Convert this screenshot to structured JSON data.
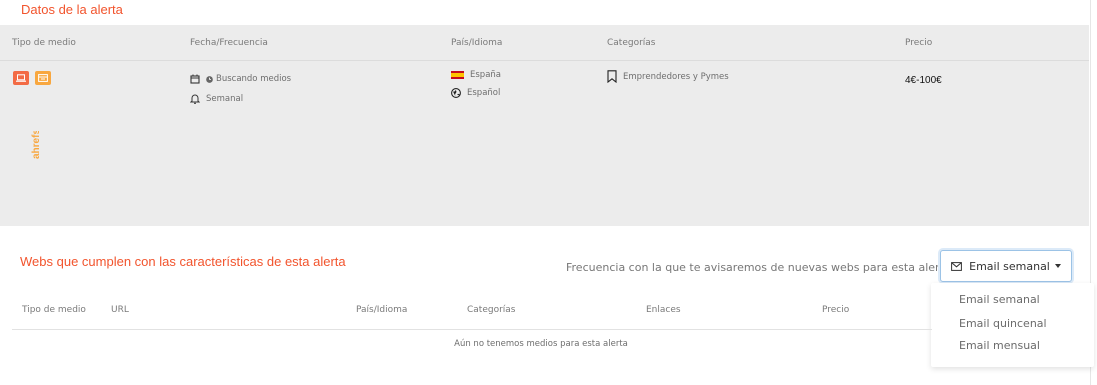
{
  "alert_section": {
    "title": "Datos de la alerta",
    "columns": [
      "Tipo de medio",
      "Fecha/Frecuencia",
      "País/Idioma",
      "Categorías",
      "Precio"
    ],
    "row": {
      "media_icons": [
        "laptop-icon",
        "browser-window-icon"
      ],
      "status": "Buscando medios",
      "frequency": "Semanal",
      "country": "España",
      "language": "Español",
      "category": "Emprendedores y Pymes",
      "price": "4€-100€",
      "logo_text": "ahrefs"
    }
  },
  "webs_section": {
    "title": "Webs que cumplen con las características de esta alerta",
    "frequency_label": "Frecuencia con la que te avisaremos de nuevas webs para esta alerta:",
    "dropdown": {
      "selected": "Email semanal",
      "options": [
        "Email semanal",
        "Email quincenal",
        "Email mensual"
      ]
    },
    "columns": [
      "Tipo de medio",
      "URL",
      "País/Idioma",
      "Categorías",
      "Enlaces",
      "Precio"
    ],
    "empty_message": "Aún no tenemos medios para esta alerta"
  },
  "colors": {
    "accent": "#f2542d",
    "panel_bg": "#ececec",
    "media_red": "#f36b45",
    "media_orange": "#f8a73f"
  }
}
